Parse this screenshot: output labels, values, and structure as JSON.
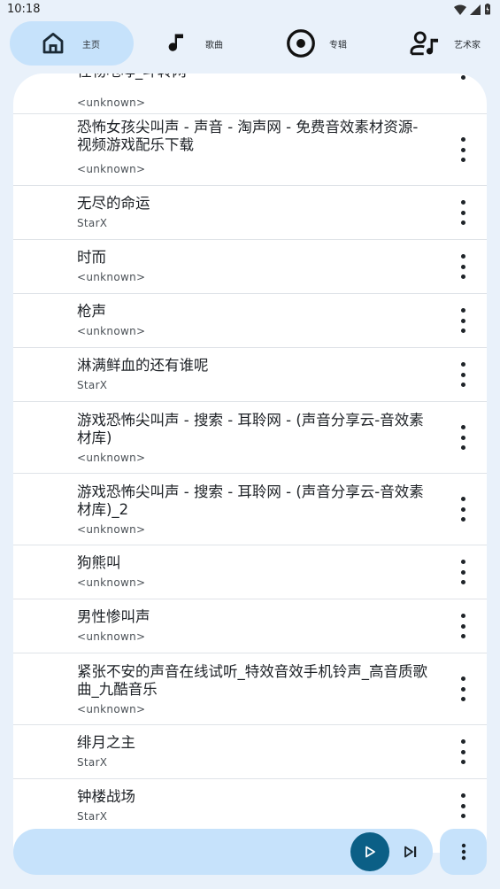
{
  "status_bar": {
    "time": "10:18"
  },
  "nav": {
    "tabs": [
      {
        "label": "主页",
        "icon": "home-icon",
        "active": true
      },
      {
        "label": "歌曲",
        "icon": "music-note-icon",
        "active": false
      },
      {
        "label": "专辑",
        "icon": "album-icon",
        "active": false
      },
      {
        "label": "艺术家",
        "icon": "artist-icon",
        "active": false
      }
    ]
  },
  "songs": [
    {
      "title": "怪物咆哮_斗转网",
      "artist": "<unknown>"
    },
    {
      "title": "恐怖女孩尖叫声 - 声音 - 淘声网 - 免费音效素材资源-视频游戏配乐下载",
      "artist": "<unknown>"
    },
    {
      "title": "无尽的命运",
      "artist": "StarX"
    },
    {
      "title": "时而",
      "artist": "<unknown>"
    },
    {
      "title": "枪声",
      "artist": "<unknown>"
    },
    {
      "title": "淋满鲜血的还有谁呢",
      "artist": "StarX"
    },
    {
      "title": "游戏恐怖尖叫声 - 搜索 - 耳聆网 - (声音分享云-音效素材库)",
      "artist": "<unknown>"
    },
    {
      "title": "游戏恐怖尖叫声 - 搜索 - 耳聆网 - (声音分享云-音效素材库)_2",
      "artist": "<unknown>"
    },
    {
      "title": "狗熊叫",
      "artist": "<unknown>"
    },
    {
      "title": "男性惨叫声",
      "artist": "<unknown>"
    },
    {
      "title": "紧张不安的声音在线试听_特效音效手机铃声_高音质歌曲_九酷音乐",
      "artist": "<unknown>"
    },
    {
      "title": "绯月之主",
      "artist": "StarX"
    },
    {
      "title": "钟楼战场",
      "artist": "StarX"
    }
  ],
  "player": {
    "play_icon": "play-icon",
    "next_icon": "skip-next-icon",
    "more_icon": "more-vert-icon"
  },
  "colors": {
    "accent": "#0b5f86",
    "surface_tint": "#c6e2fb",
    "background": "#e9f1fa"
  }
}
